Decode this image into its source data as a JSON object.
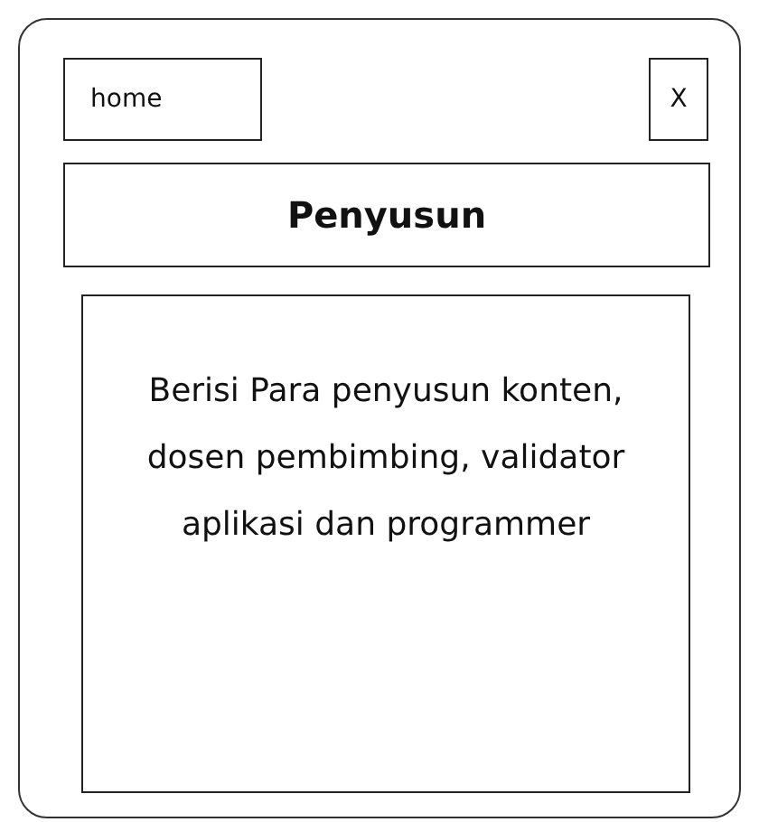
{
  "header": {
    "home_button": "home",
    "close_button": "X"
  },
  "title": "Penyusun",
  "content": "Berisi Para penyusun konten, dosen pembimbing, validator aplikasi dan programmer"
}
